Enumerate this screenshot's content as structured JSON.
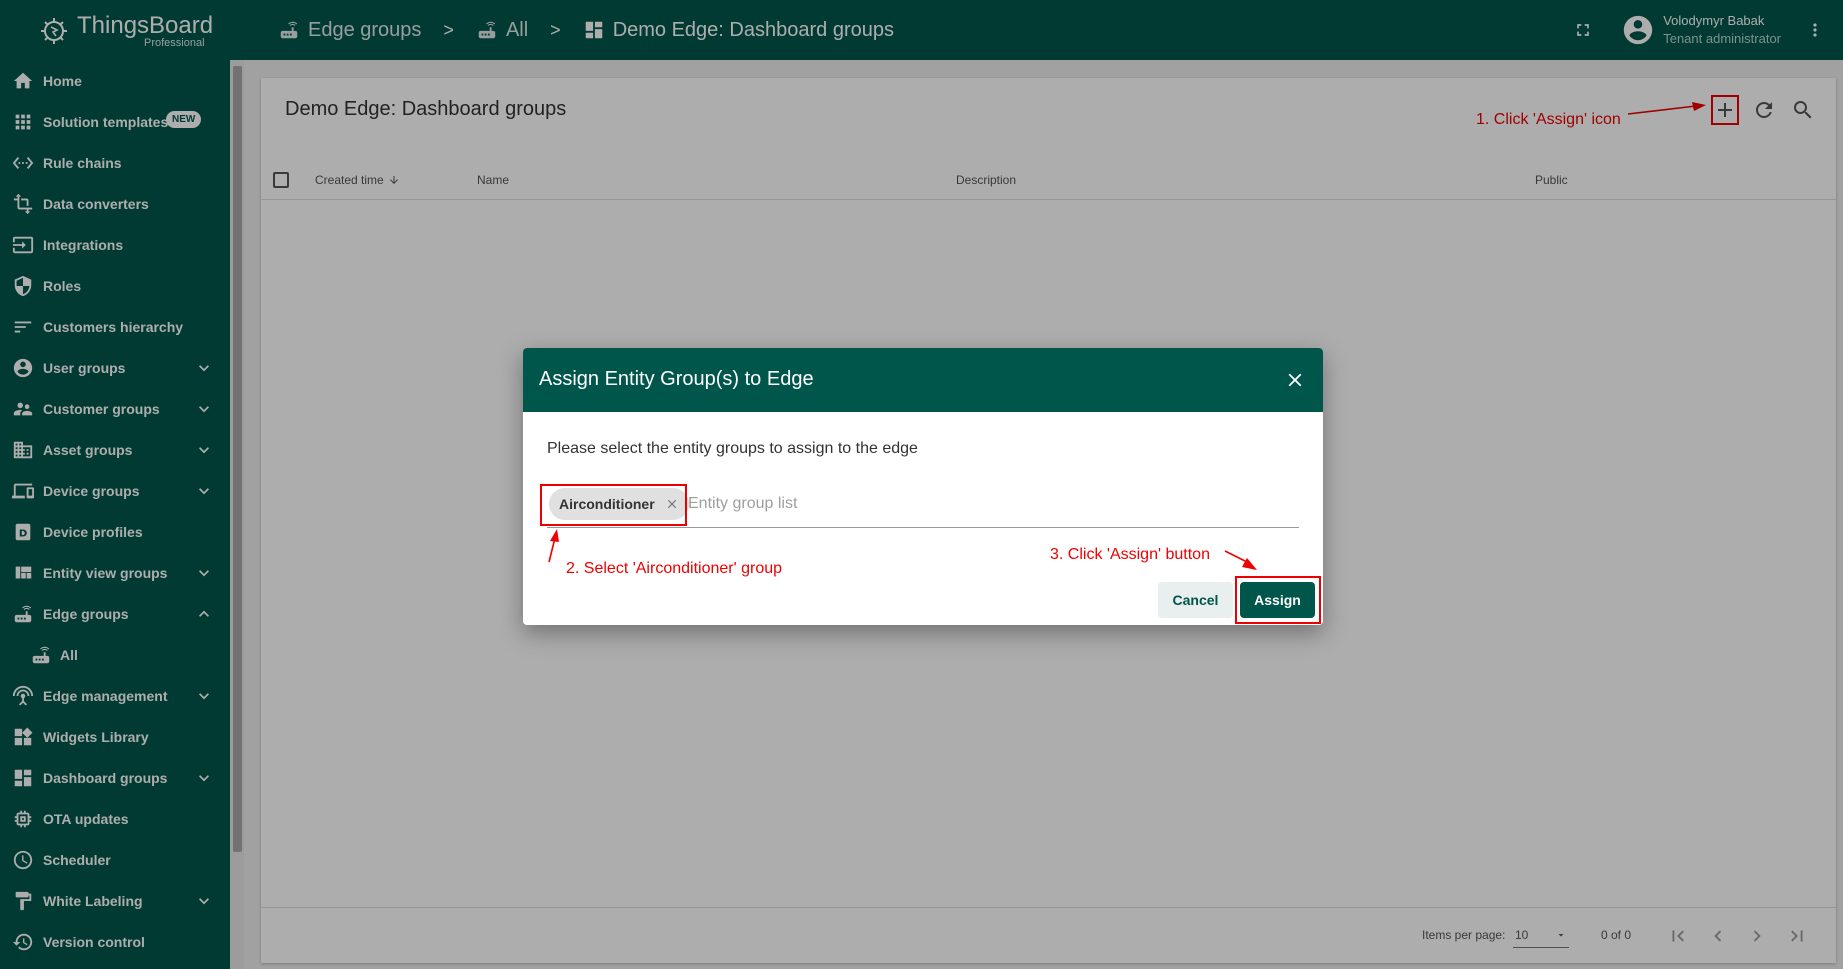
{
  "brand": {
    "name": "ThingsBoard",
    "edition": "Professional"
  },
  "breadcrumbs": [
    {
      "label": "Edge groups"
    },
    {
      "label": "All"
    },
    {
      "label": "Demo Edge: Dashboard groups"
    }
  ],
  "breadcrumb_separator": ">",
  "user": {
    "name": "Volodymyr Babak",
    "role": "Tenant administrator"
  },
  "sidebar": {
    "items": [
      {
        "label": "Home",
        "icon": "home-icon"
      },
      {
        "label": "Solution templates",
        "icon": "apps-grid-icon",
        "badge": "NEW"
      },
      {
        "label": "Rule chains",
        "icon": "settings-ethernet-icon"
      },
      {
        "label": "Data converters",
        "icon": "transform-icon"
      },
      {
        "label": "Integrations",
        "icon": "input-icon"
      },
      {
        "label": "Roles",
        "icon": "security-shield-icon"
      },
      {
        "label": "Customers hierarchy",
        "icon": "sort-lines-icon"
      },
      {
        "label": "User groups",
        "icon": "account-circle-icon"
      },
      {
        "label": "Customer groups",
        "icon": "supervisor-account-icon"
      },
      {
        "label": "Asset groups",
        "icon": "domain-icon"
      },
      {
        "label": "Device groups",
        "icon": "devices-icon"
      },
      {
        "label": "Device profiles",
        "icon": "device-profile-icon"
      },
      {
        "label": "Entity view groups",
        "icon": "view-quilt-icon"
      },
      {
        "label": "Edge groups",
        "icon": "router-icon"
      },
      {
        "label": "All",
        "icon": "router-icon"
      },
      {
        "label": "Edge management",
        "icon": "settings-input-antenna-icon"
      },
      {
        "label": "Widgets Library",
        "icon": "widgets-icon"
      },
      {
        "label": "Dashboard groups",
        "icon": "dashboard-icon"
      },
      {
        "label": "OTA updates",
        "icon": "memory-chip-icon"
      },
      {
        "label": "Scheduler",
        "icon": "schedule-clock-icon"
      },
      {
        "label": "White Labeling",
        "icon": "format-paint-icon"
      },
      {
        "label": "Version control",
        "icon": "history-icon"
      }
    ]
  },
  "main": {
    "title": "Demo Edge: Dashboard groups",
    "columns": [
      "Created time",
      "Name",
      "Description",
      "Public"
    ],
    "paginator": {
      "items_per_page_label": "Items per page:",
      "items_per_page_value": "10",
      "range": "0 of 0"
    }
  },
  "annotations": {
    "step1": "1. Click 'Assign' icon",
    "step2": "2. Select 'Airconditioner' group",
    "step3": "3. Click 'Assign' button",
    "highlight_color": "#ee0000"
  },
  "dialog": {
    "title": "Assign Entity Group(s) to Edge",
    "prompt": "Please select the entity groups to assign to the edge",
    "chips": [
      "Airconditioner"
    ],
    "input_placeholder": "Entity group list",
    "cancel_label": "Cancel",
    "assign_label": "Assign"
  },
  "colors": {
    "primary": "#00564a",
    "annotation": "#ee0000"
  }
}
